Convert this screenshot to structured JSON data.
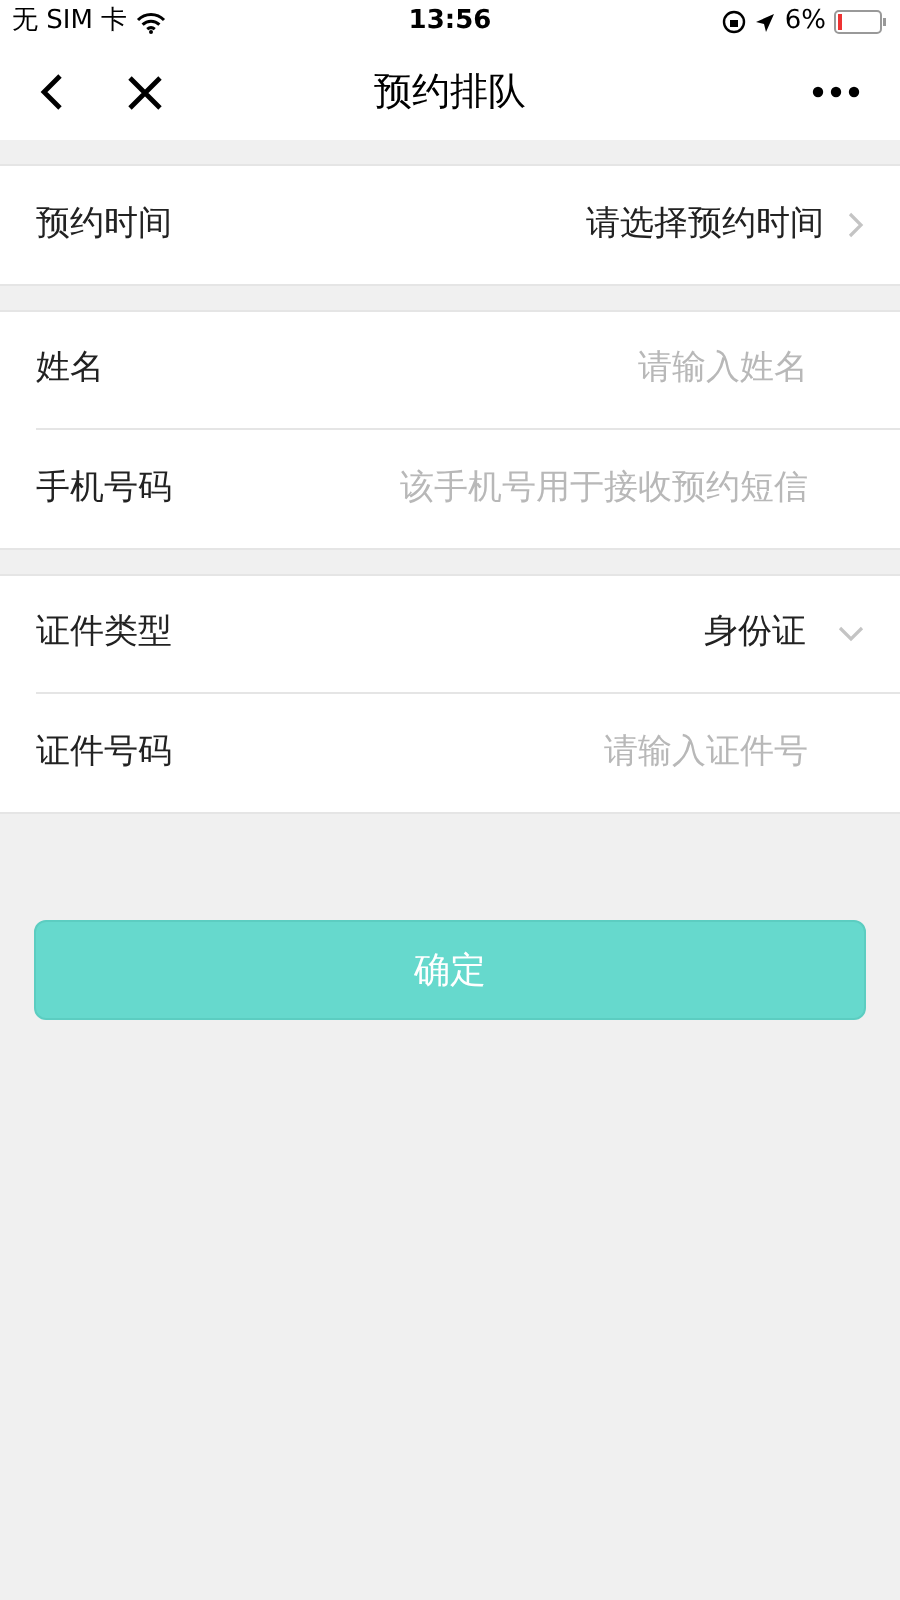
{
  "status_bar": {
    "carrier": "无 SIM 卡",
    "time": "13:56",
    "battery": "6%"
  },
  "nav": {
    "title": "预约排队"
  },
  "groups": [
    {
      "rows": [
        {
          "kind": "select",
          "label": "预约时间",
          "value": "请选择预约时间"
        }
      ]
    },
    {
      "rows": [
        {
          "kind": "input",
          "label": "姓名",
          "placeholder": "请输入姓名"
        },
        {
          "kind": "input",
          "label": "手机号码",
          "placeholder": "该手机号用于接收预约短信"
        }
      ]
    },
    {
      "rows": [
        {
          "kind": "dropdown",
          "label": "证件类型",
          "value": "身份证"
        },
        {
          "kind": "input",
          "label": "证件号码",
          "placeholder": "请输入证件号"
        }
      ]
    }
  ],
  "submit": {
    "label": "确定",
    "disabled": true
  }
}
